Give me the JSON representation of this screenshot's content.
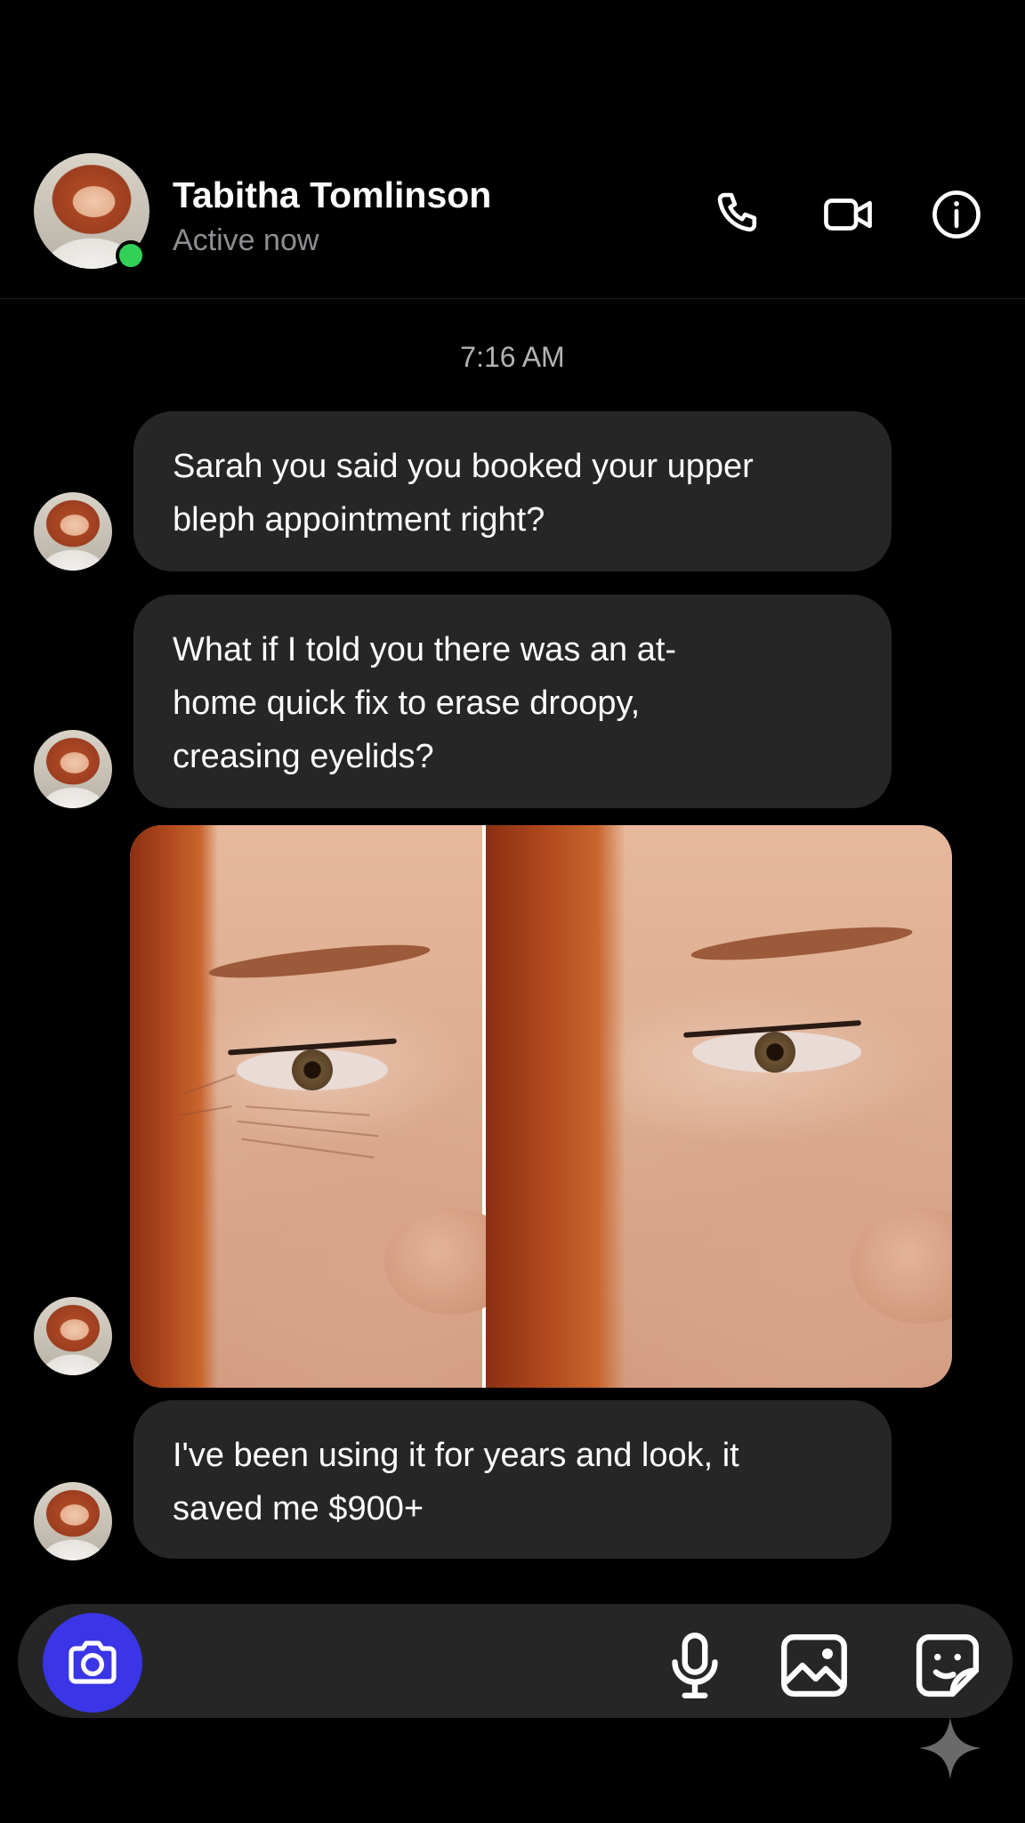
{
  "header": {
    "contact_name": "Tabitha Tomlinson",
    "status": "Active now",
    "status_color": "#31d158",
    "actions": [
      "phone-icon",
      "video-camera-icon",
      "info-icon"
    ]
  },
  "conversation": {
    "timestamp": "7:16 AM",
    "messages": [
      {
        "type": "text",
        "lines": [
          "Sarah you said you booked your upper",
          "bleph appointment right?"
        ]
      },
      {
        "type": "text",
        "lines": [
          "What if I told you there was an at-",
          "home quick fix to erase droopy,",
          "creasing eyelids?"
        ]
      },
      {
        "type": "image",
        "description_icon": "before-after-photo"
      },
      {
        "type": "text",
        "lines": [
          "I've been using it for years and look, it",
          "saved me $900+"
        ]
      }
    ]
  },
  "composer": {
    "camera_button_color": "#3a35e6",
    "tools": [
      "microphone-icon",
      "gallery-icon",
      "sticker-icon"
    ]
  },
  "colors": {
    "background": "#000000",
    "bubble": "#262626",
    "secondary_text": "#8e8e93"
  }
}
